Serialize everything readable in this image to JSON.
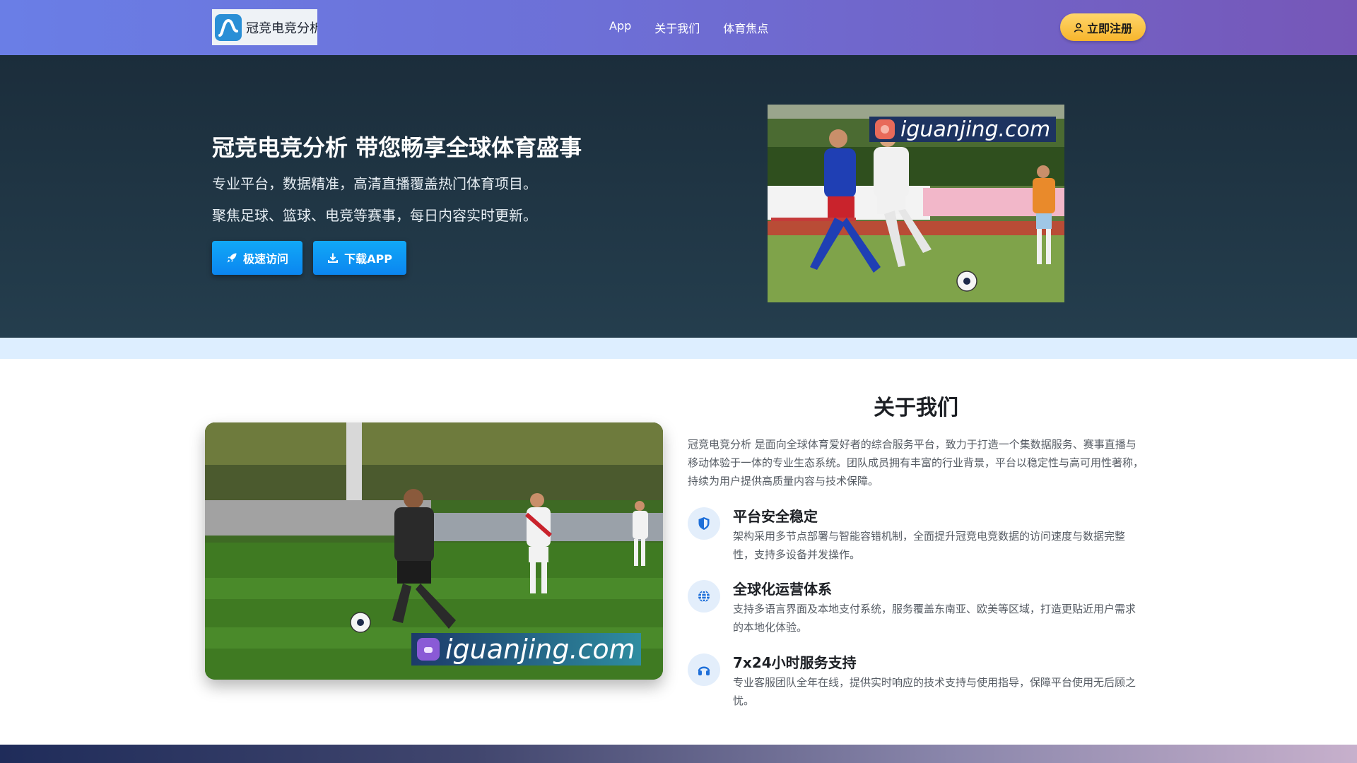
{
  "nav": {
    "logo_text": "冠竞电竞分析",
    "links": [
      {
        "label": "App"
      },
      {
        "label": "关于我们"
      },
      {
        "label": "体育焦点"
      }
    ],
    "register_label": "立即注册"
  },
  "hero": {
    "title": "冠竞电竞分析 带您畅享全球体育盛事",
    "subtitle_1": "专业平台，数据精准，高清直播覆盖热门体育项目。",
    "subtitle_2": "聚焦足球、篮球、电竞等赛事，每日内容实时更新。",
    "btn_fast": "极速访问",
    "btn_download": "下载APP",
    "watermark": "iguanjing.com"
  },
  "about": {
    "title": "关于我们",
    "description": "冠竞电竞分析 是面向全球体育爱好者的综合服务平台，致力于打造一个集数据服务、赛事直播与移动体验于一体的专业生态系统。团队成员拥有丰富的行业背景，平台以稳定性与高可用性著称，持续为用户提供高质量内容与技术保障。",
    "watermark": "iguanjing.com",
    "features": [
      {
        "icon": "shield-icon",
        "title": "平台安全稳定",
        "desc": "架构采用多节点部署与智能容错机制，全面提升冠竞电竞数据的访问速度与数据完整性，支持多设备并发操作。"
      },
      {
        "icon": "globe-icon",
        "title": "全球化运营体系",
        "desc": "支持多语言界面及本地支付系统，服务覆盖东南亚、欧美等区域，打造更贴近用户需求的本地化体验。"
      },
      {
        "icon": "headset-icon",
        "title": "7x24小时服务支持",
        "desc": "专业客服团队全年在线，提供实时响应的技术支持与使用指导，保障平台使用无后顾之忧。"
      }
    ]
  },
  "colors": {
    "accent": "#0b86f0",
    "register": "#f7b52c",
    "icon_blue": "#1e6fd9"
  }
}
